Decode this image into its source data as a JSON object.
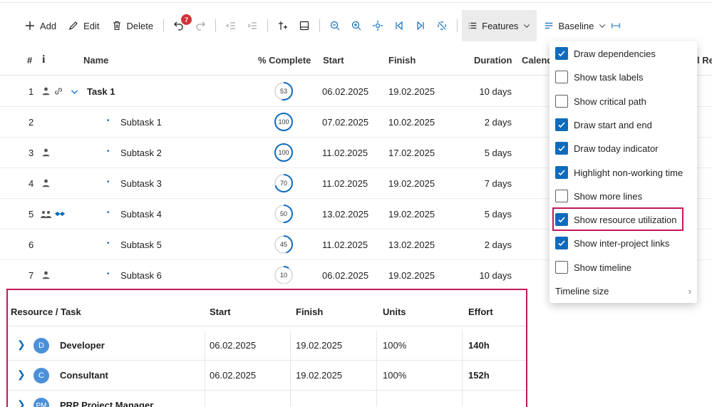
{
  "toolbar": {
    "add": "Add",
    "edit": "Edit",
    "delete": "Delete",
    "undo_badge": "7",
    "features": "Features",
    "baseline": "Baseline"
  },
  "grid": {
    "columns": [
      "#",
      "i",
      "Name",
      "% Complete",
      "Start",
      "Finish",
      "Duration",
      "Calend",
      "l Re"
    ],
    "rows": [
      {
        "num": "1",
        "name": "Task 1",
        "pct": "53",
        "pct_value": 53,
        "start": "06.02.2025",
        "finish": "19.02.2025",
        "duration": "10 days"
      },
      {
        "num": "2",
        "name": "Subtask 1",
        "pct": "100",
        "pct_value": 100,
        "start": "07.02.2025",
        "finish": "10.02.2025",
        "duration": "2 days"
      },
      {
        "num": "3",
        "name": "Subtask 2",
        "pct": "100",
        "pct_value": 100,
        "start": "11.02.2025",
        "finish": "17.02.2025",
        "duration": "5 days"
      },
      {
        "num": "4",
        "name": "Subtask 3",
        "pct": "70",
        "pct_value": 70,
        "start": "11.02.2025",
        "finish": "19.02.2025",
        "duration": "7 days"
      },
      {
        "num": "5",
        "name": "Subtask 4",
        "pct": "50",
        "pct_value": 50,
        "start": "13.02.2025",
        "finish": "19.02.2025",
        "duration": "5 days"
      },
      {
        "num": "6",
        "name": "Subtask 5",
        "pct": "45",
        "pct_value": 45,
        "start": "11.02.2025",
        "finish": "13.02.2025",
        "duration": "2 days"
      },
      {
        "num": "7",
        "name": "Subtask 6",
        "pct": "10",
        "pct_value": 10,
        "start": "06.02.2025",
        "finish": "19.02.2025",
        "duration": "10 days"
      }
    ]
  },
  "features_menu": {
    "items": [
      {
        "label": "Draw dependencies",
        "checked": true
      },
      {
        "label": "Show task labels",
        "checked": false
      },
      {
        "label": "Show critical path",
        "checked": false
      },
      {
        "label": "Draw start and end",
        "checked": true
      },
      {
        "label": "Draw today indicator",
        "checked": true
      },
      {
        "label": "Highlight non-working time",
        "checked": true
      },
      {
        "label": "Show more lines",
        "checked": false
      },
      {
        "label": "Show resource utilization",
        "checked": true
      },
      {
        "label": "Show inter-project links",
        "checked": true
      },
      {
        "label": "Show timeline",
        "checked": false
      }
    ],
    "timeline_size": "Timeline size"
  },
  "resources": {
    "columns": [
      "Resource / Task",
      "Start",
      "Finish",
      "Units",
      "Effort"
    ],
    "rows": [
      {
        "initial": "D",
        "name": "Developer",
        "start": "06.02.2025",
        "finish": "19.02.2025",
        "units": "100%",
        "effort": "140h"
      },
      {
        "initial": "C",
        "name": "Consultant",
        "start": "06.02.2025",
        "finish": "19.02.2025",
        "units": "100%",
        "effort": "152h"
      },
      {
        "initial": "PM",
        "name": "PRP Project Manager",
        "start": "",
        "finish": "",
        "units": "",
        "effort": ""
      }
    ]
  },
  "colors": {
    "accent": "#0f6cbd",
    "highlight": "#c2185b",
    "badge": "#d13438"
  }
}
